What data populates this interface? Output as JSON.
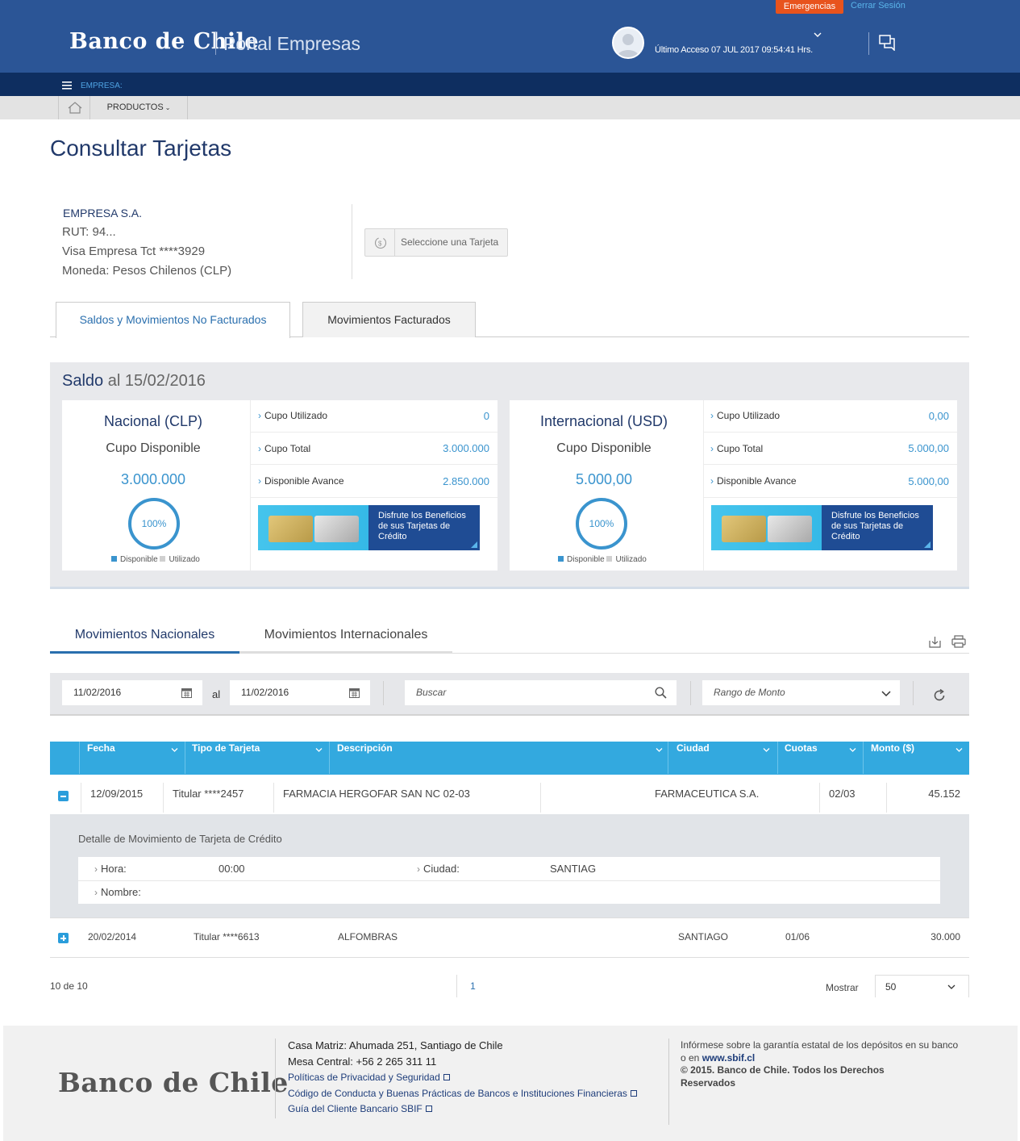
{
  "header": {
    "brand": "Banco de Chile",
    "portal": "Portal Empresas",
    "emergencias": "Emergencias",
    "cerrar_sesion": "Cerrar Sesión",
    "last_access": "Último Acceso 07 JUL 2017 09:54:41 Hrs."
  },
  "subbar": {
    "empresa": "EMPRESA:"
  },
  "nav": {
    "productos": "PRODUCTOS"
  },
  "page": {
    "title": "Consultar Tarjetas"
  },
  "company": {
    "name": "EMPRESA S.A.",
    "rut": "RUT: 94...",
    "card": "Visa Empresa Tct ****3929",
    "currency": "Moneda: Pesos Chilenos (CLP)",
    "select_card": "Seleccione una Tarjeta"
  },
  "tabs": [
    "Saldos y Movimientos No Facturados",
    "Movimientos Facturados"
  ],
  "saldo": {
    "title_bold": "Saldo",
    "title_rest": " al 15/02/2016",
    "nacional": {
      "title": "Nacional (CLP)",
      "subtitle": "Cupo Disponible",
      "amount": "3.000.000",
      "percent": "100%",
      "percent_available": 1.0,
      "rows": [
        {
          "label": "Cupo Utilizado",
          "value": "0"
        },
        {
          "label": "Cupo Total",
          "value": "3.000.000"
        },
        {
          "label": "Disponible Avance",
          "value": "2.850.000"
        }
      ]
    },
    "internacional": {
      "title": "Internacional (USD)",
      "subtitle": "Cupo Disponible",
      "amount": "5.000,00",
      "percent": "100%",
      "percent_available": 1.0,
      "rows": [
        {
          "label": "Cupo Utilizado",
          "value": "0,00"
        },
        {
          "label": "Cupo Total",
          "value": "5.000,00"
        },
        {
          "label": "Disponible Avance",
          "value": "5.000,00"
        }
      ]
    },
    "legend": {
      "disponible": "Disponible",
      "utilizado": "Utilizado"
    },
    "promo": "Disfrute los Beneficios de sus Tarjetas de Crédito",
    "colors": {
      "accent": "#3a94ce",
      "dark": "#21396a",
      "utilizado": "#d0d0d0"
    }
  },
  "movements": {
    "tabs": [
      "Movimientos Nacionales",
      "Movimientos Internacionales"
    ],
    "filters": {
      "date_from": "11/02/2016",
      "al": "al",
      "date_to": "11/02/2016",
      "search_placeholder": "Buscar",
      "range_placeholder": "Rango de Monto"
    },
    "columns": [
      "Fecha",
      "Tipo de Tarjeta",
      "Descripción",
      "Ciudad",
      "Cuotas",
      "Monto ($)"
    ],
    "rows": [
      {
        "fecha": "12/09/2015",
        "tipo": "Titular ****2457",
        "descripcion": "FARMACIA HERGOFAR SAN NC 02-03",
        "ciudad": "FARMACEUTICA S.A.",
        "cuotas": "02/03",
        "monto": "45.152"
      },
      {
        "fecha": "20/02/2014",
        "tipo": "Titular ****6613",
        "descripcion": "ALFOMBRAS",
        "ciudad": "SANTIAGO",
        "cuotas": "01/06",
        "monto": "30.000"
      }
    ],
    "detail": {
      "title": "Detalle de Movimiento de Tarjeta de Crédito",
      "hora_label": "Hora:",
      "hora": "00:00",
      "ciudad_label": "Ciudad:",
      "ciudad": "SANTIAG",
      "nombre_label": "Nombre:"
    },
    "pager": {
      "count": "10 de 10",
      "page": "1",
      "mostrar": "Mostrar",
      "per_page": "50"
    }
  },
  "footer": {
    "brand": "Banco de Chile",
    "address": "Casa Matriz: Ahumada 251, Santiago de Chile",
    "phone": "Mesa Central: +56 2 265 311 11",
    "links": [
      "Políticas de Privacidad y Seguridad",
      "Código de Conducta y Buenas Prácticas de Bancos e Instituciones Financieras",
      "Guía del Cliente Bancario SBIF"
    ],
    "garantia": "Infórmese sobre la garantía estatal de los depósitos en su banco o en",
    "sbif": "www.sbif.cl",
    "copyright": "© 2015. Banco de Chile. Todos los Derechos Reservados"
  }
}
